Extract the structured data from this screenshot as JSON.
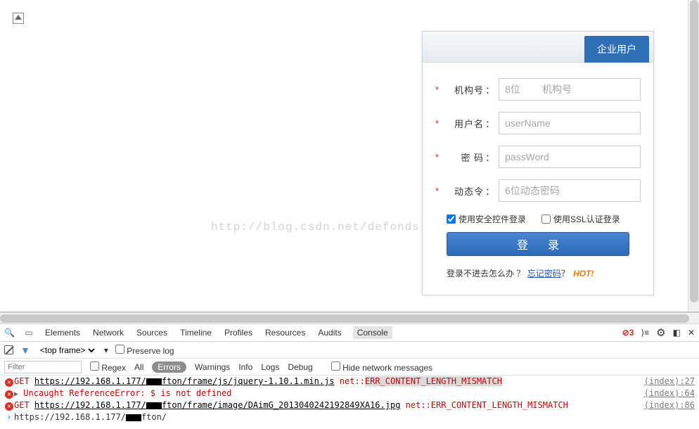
{
  "form": {
    "tab_label": "企业用户",
    "org_label": "机构号",
    "org_placeholder": "8位        机构号",
    "user_label": "用户名",
    "user_placeholder": "userName",
    "pass_label": "密  码",
    "pass_placeholder": "passWord",
    "otp_label": "动态令",
    "otp_placeholder": "6位动态密码",
    "chk_secure": "使用安全控件登录",
    "chk_ssl": "使用SSL认证登录",
    "login_btn": "登录",
    "help_text": "登录不进去怎么办  ？",
    "forgot_link": "忘记密码",
    "q_mark": "？",
    "hot": "HOT!"
  },
  "watermark": "http://blog.csdn.net/defonds",
  "devtools": {
    "tabs": [
      "Elements",
      "Network",
      "Sources",
      "Timeline",
      "Profiles",
      "Resources",
      "Audits",
      "Console"
    ],
    "active_tab": "Console",
    "error_count": "3",
    "frame_selector": "<top frame>",
    "preserve_log": "Preserve log",
    "filter_placeholder": "Filter",
    "regex": "Regex",
    "levels": [
      "All",
      "Errors",
      "Warnings",
      "Info",
      "Logs",
      "Debug"
    ],
    "active_level": "Errors",
    "hide_net": "Hide network messages",
    "lines": [
      {
        "type": "neterr",
        "method": "GET",
        "url_pre": "https://192.168.1.177/",
        "url_post": "fton/frame/js/jquery-1.10.1.min.js",
        "net": " net::",
        "err": "ERR_CONTENT_LENGTH_MISMATCH",
        "src": "(index):27"
      },
      {
        "type": "jserr",
        "expand": true,
        "text": "Uncaught ReferenceError: $ is not defined",
        "src": "(index):64"
      },
      {
        "type": "neterr",
        "method": "GET",
        "url_pre": "https://192.168.1.177/",
        "url_post": "fton/frame/image/DAimG_2013040242192849XA16.jpg",
        "net": " net::",
        "err": "ERR_CONTENT_LENGTH_MISMATCH",
        "src": "(index):86"
      },
      {
        "type": "prompt",
        "text": "https://192.168.1.177/",
        "tail": "fton/"
      }
    ]
  }
}
